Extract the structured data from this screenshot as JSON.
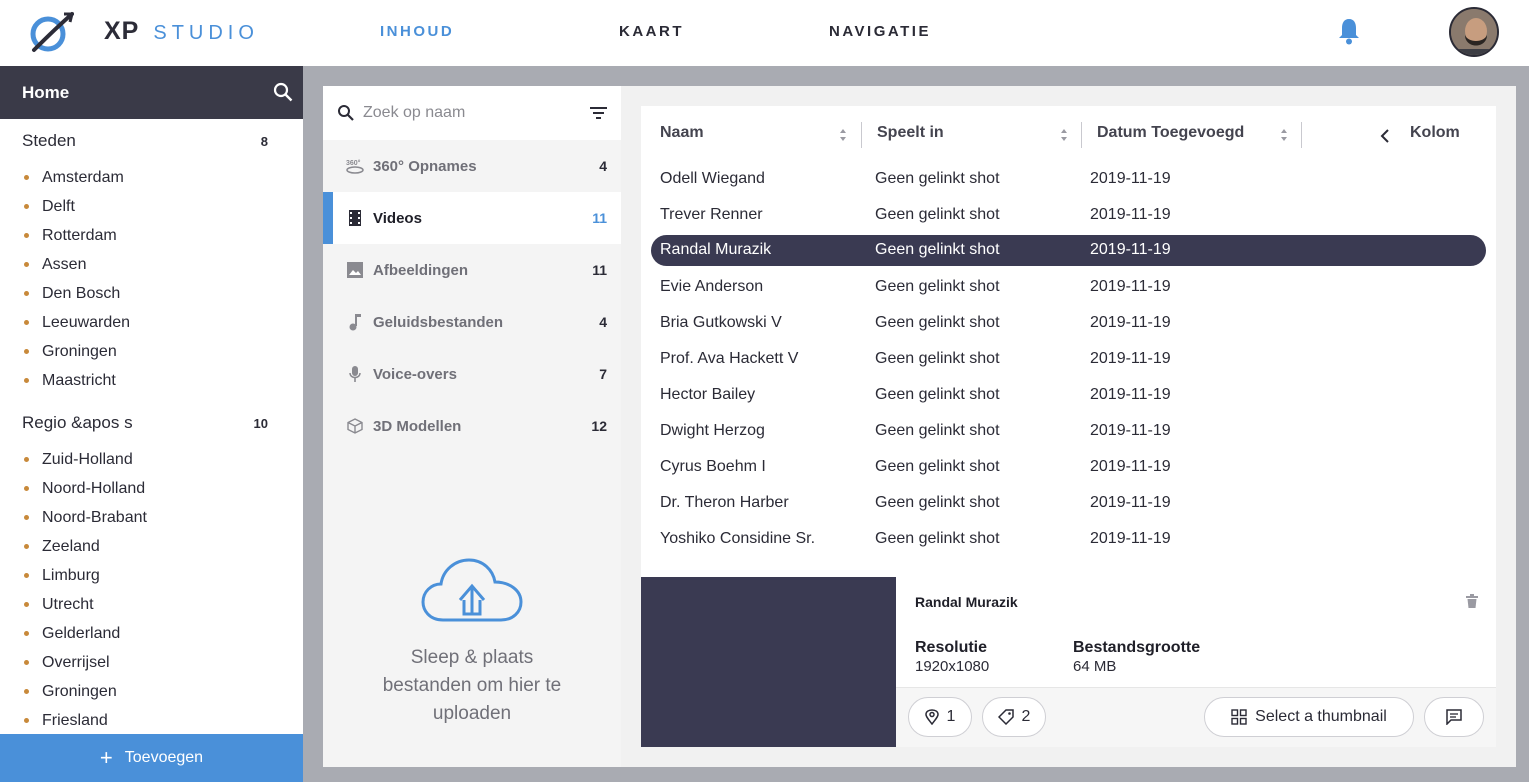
{
  "header": {
    "brand_xp": "XP",
    "brand_studio": "STUDIO",
    "nav": [
      "INHOUD",
      "KAART",
      "NAVIGATIE"
    ],
    "accent": "#4a90d9"
  },
  "sidebar": {
    "title": "Home",
    "groups": [
      {
        "label": "Steden",
        "count": "8",
        "items": [
          "Amsterdam",
          "Delft",
          "Rotterdam",
          "Assen",
          "Den Bosch",
          "Leeuwarden",
          "Groningen",
          "Maastricht"
        ]
      },
      {
        "label": "Regio &apos s",
        "count": "10",
        "items": [
          "Zuid-Holland",
          "Noord-Holland",
          "Noord-Brabant",
          "Zeeland",
          "Limburg",
          "Utrecht",
          "Gelderland",
          "Overrijsel",
          "Groningen",
          "Friesland"
        ]
      }
    ],
    "add_label": "Toevoegen"
  },
  "media": {
    "search_placeholder": "Zoek op naam",
    "categories": [
      {
        "label": "360° Opnames",
        "count": "4",
        "icon": "360-icon"
      },
      {
        "label": "Videos",
        "count": "11",
        "icon": "film-icon"
      },
      {
        "label": "Afbeeldingen",
        "count": "11",
        "icon": "image-icon"
      },
      {
        "label": "Geluidsbestanden",
        "count": "4",
        "icon": "music-icon"
      },
      {
        "label": "Voice-overs",
        "count": "7",
        "icon": "microphone-icon"
      },
      {
        "label": "3D Modellen",
        "count": "12",
        "icon": "cube-icon"
      }
    ],
    "upload_text": "Sleep & plaats bestanden om hier te uploaden"
  },
  "table": {
    "columns": [
      "Naam",
      "Speelt in",
      "Datum Toegevoegd"
    ],
    "column_toggle": "Kolom",
    "rows": [
      [
        "Odell Wiegand",
        "Geen gelinkt shot",
        "2019-11-19"
      ],
      [
        "Trever Renner",
        "Geen gelinkt shot",
        "2019-11-19"
      ],
      [
        "Randal Murazik",
        "Geen gelinkt shot",
        "2019-11-19"
      ],
      [
        "Evie Anderson",
        "Geen gelinkt shot",
        "2019-11-19"
      ],
      [
        "Bria Gutkowski V",
        "Geen gelinkt shot",
        "2019-11-19"
      ],
      [
        "Prof. Ava Hackett V",
        "Geen gelinkt shot",
        "2019-11-19"
      ],
      [
        "Hector Bailey",
        "Geen gelinkt shot",
        "2019-11-19"
      ],
      [
        "Dwight Herzog",
        "Geen gelinkt shot",
        "2019-11-19"
      ],
      [
        "Cyrus Boehm I",
        "Geen gelinkt shot",
        "2019-11-19"
      ],
      [
        "Dr. Theron Harber",
        "Geen gelinkt shot",
        "2019-11-19"
      ],
      [
        "Yoshiko Considine Sr.",
        "Geen gelinkt shot",
        "2019-11-19"
      ]
    ],
    "selected_row": 2
  },
  "detail": {
    "title": "Randal Murazik",
    "resolution_label": "Resolutie",
    "resolution_value": "1920x1080",
    "size_label": "Bestandsgrootte",
    "size_value": "64 MB",
    "locations_count": "1",
    "tags_count": "2",
    "thumbnail_button": "Select a thumbnail"
  }
}
